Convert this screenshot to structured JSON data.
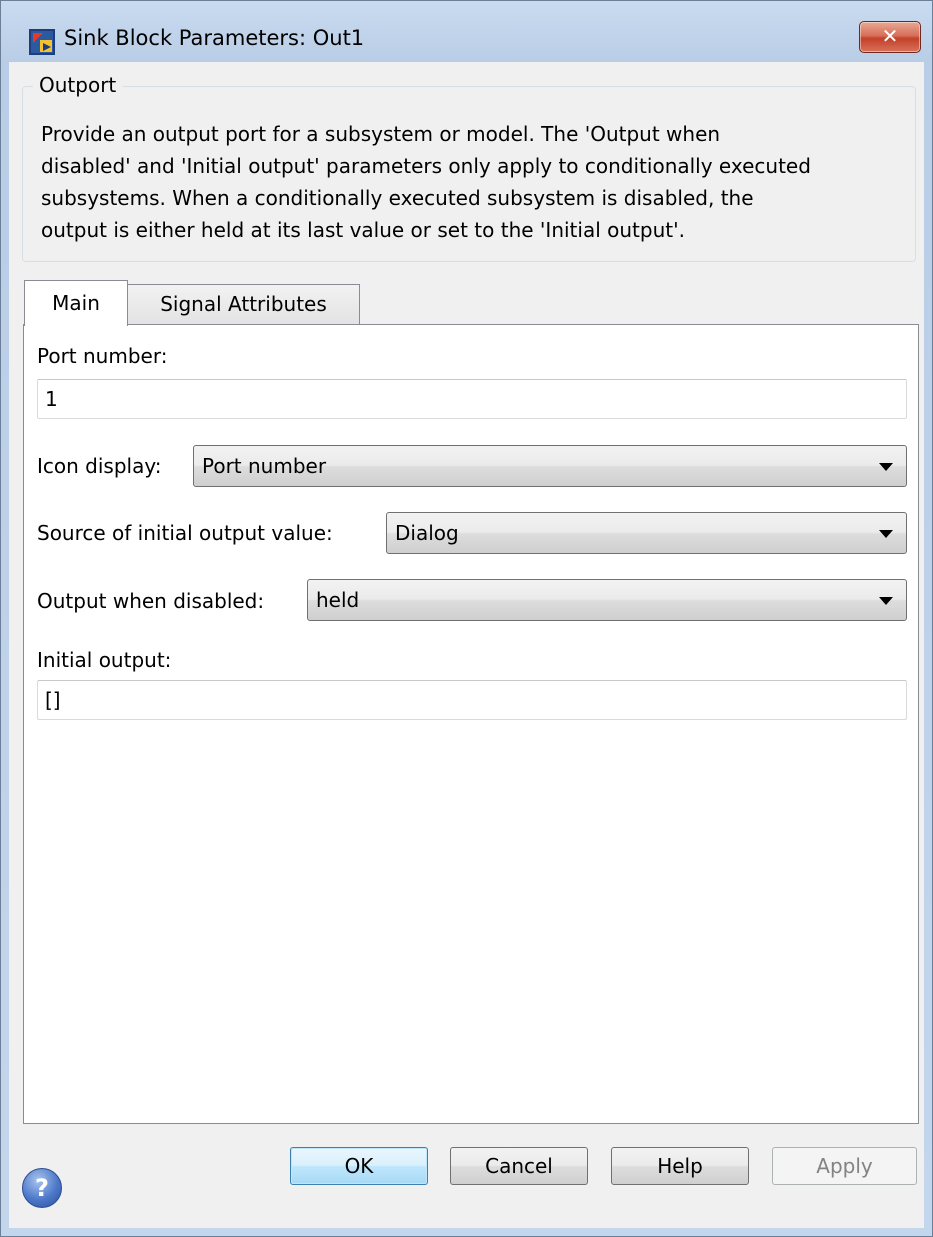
{
  "window": {
    "title": "Sink Block Parameters: Out1",
    "close_glyph": "✕",
    "icon": "simulink-block-icon"
  },
  "group": {
    "title": "Outport",
    "description_lines": [
      "Provide an output port for a subsystem or model.  The 'Output when",
      "disabled' and 'Initial output' parameters only apply to conditionally executed",
      "subsystems. When a conditionally executed subsystem is disabled, the",
      "output is either held at its last value or set to the 'Initial output'."
    ]
  },
  "tabs": [
    {
      "label": "Main",
      "selected": true
    },
    {
      "label": "Signal Attributes",
      "selected": false
    }
  ],
  "main": {
    "port_number_label": "Port number:",
    "port_number_value": "1",
    "icon_display_label": "Icon display:",
    "icon_display_value": "Port number",
    "source_initial_label": "Source of initial output value:",
    "source_initial_value": "Dialog",
    "output_disabled_label": "Output when disabled:",
    "output_disabled_value": "held",
    "initial_output_label": "Initial output:",
    "initial_output_value": "[]"
  },
  "buttons": {
    "help_icon_glyph": "?",
    "ok": "OK",
    "cancel": "Cancel",
    "help": "Help",
    "apply": "Apply"
  },
  "colors": {
    "title_gradient": "#c9dbf0",
    "client_bg": "#f0f0f0",
    "close_red": "#c2412a",
    "ok_border": "#3c7fb1"
  }
}
